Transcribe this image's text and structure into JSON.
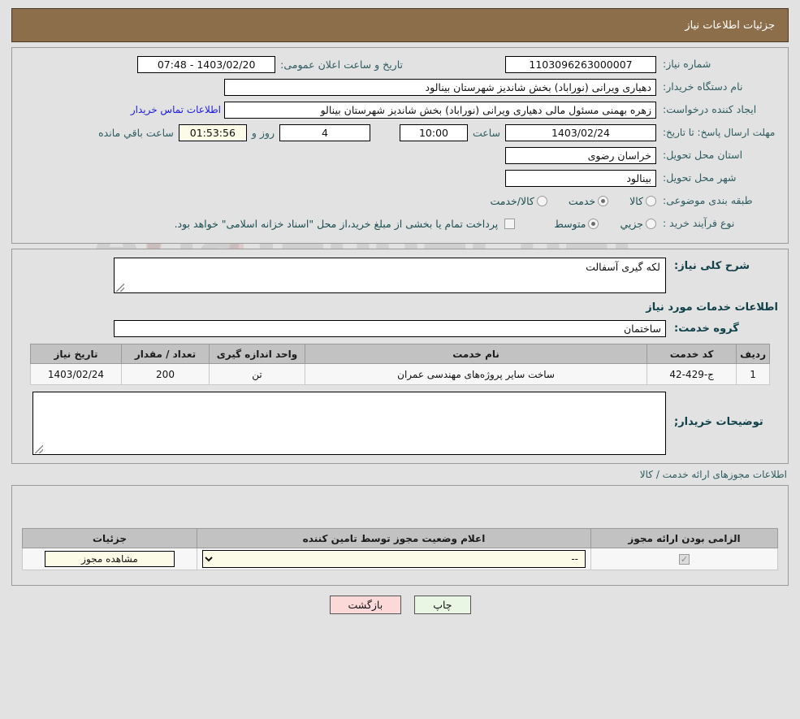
{
  "header": {
    "title": "جزئیات اطلاعات نیاز"
  },
  "watermark": {
    "text": "AriaTender.net"
  },
  "info": {
    "need_number_label": "شماره نیاز:",
    "need_number_value": "1103096263000007",
    "announce_datetime_label": "تاریخ و ساعت اعلان عمومی:",
    "announce_datetime_value": "1403/02/20 - 07:48",
    "buyer_org_label": "نام دستگاه خریدار:",
    "buyer_org_value": "دهیاری ویرانی (نوراباد) بخش شاندیز شهرستان بینالود",
    "creator_label": "ایجاد کننده درخواست:",
    "creator_value": "زهره بهمنی مسئول مالی دهیاری ویرانی (نوراباد) بخش شاندیز شهرستان بینالو",
    "contact_link": "اطلاعات تماس خریدار",
    "deadline_label": "مهلت ارسال پاسخ: تا تاریخ:",
    "deadline_date": "1403/02/24",
    "deadline_hour_label": "ساعت",
    "deadline_hour": "10:00",
    "remaining_days": "4",
    "remaining_days_suffix": "روز و",
    "remaining_time": "01:53:56",
    "remaining_suffix": "ساعت باقي مانده",
    "province_label": "استان محل تحویل:",
    "province_value": "خراسان رضوی",
    "city_label": "شهر محل تحویل:",
    "city_value": "بینالود",
    "category_label": "طبقه بندی موضوعی:",
    "category_options": [
      {
        "label": "کالا",
        "selected": false
      },
      {
        "label": "خدمت",
        "selected": true
      },
      {
        "label": "کالا/خدمت",
        "selected": false
      }
    ],
    "process_label": "نوع فرآیند خرید :",
    "process_options": [
      {
        "label": "جزیي",
        "selected": false
      },
      {
        "label": "متوسط",
        "selected": true
      }
    ],
    "treasury_checked": false,
    "treasury_note": "پرداخت تمام یا بخشی از مبلغ خرید،از محل \"اسناد خزانه اسلامی\" خواهد بود."
  },
  "description": {
    "general_label": "شرح کلی نیاز:",
    "general_value": "لکه گیری آسفالت",
    "services_section_title": "اطلاعات خدمات مورد نیاز",
    "service_group_label": "گروه خدمت:",
    "service_group_value": "ساختمان",
    "buyer_notes_label": "توضیحات خریدار;",
    "buyer_notes_value": ""
  },
  "services_table": {
    "columns": [
      "ردیف",
      "کد خدمت",
      "نام خدمت",
      "واحد اندازه گیری",
      "تعداد / مقدار",
      "تاریخ نیاز"
    ],
    "rows": [
      {
        "radif": "1",
        "code": "ج-429-42",
        "name": "ساخت سایر پروژه‌های مهندسی عمران",
        "unit": "تن",
        "quantity": "200",
        "need_date": "1403/02/24"
      }
    ]
  },
  "licenses": {
    "section_title": "اطلاعات مجوزهای ارائه خدمت / کالا",
    "columns": [
      "الزامی بودن ارائه مجوز",
      "اعلام وضعیت مجوز توسط تامین کننده",
      "جزئیات"
    ],
    "rows": [
      {
        "required_checked": true,
        "status_selected": "--",
        "status_options": [
          "--"
        ],
        "details_button": "مشاهده مجوز"
      }
    ]
  },
  "footer": {
    "print_label": "چاپ",
    "back_label": "بازگشت"
  }
}
